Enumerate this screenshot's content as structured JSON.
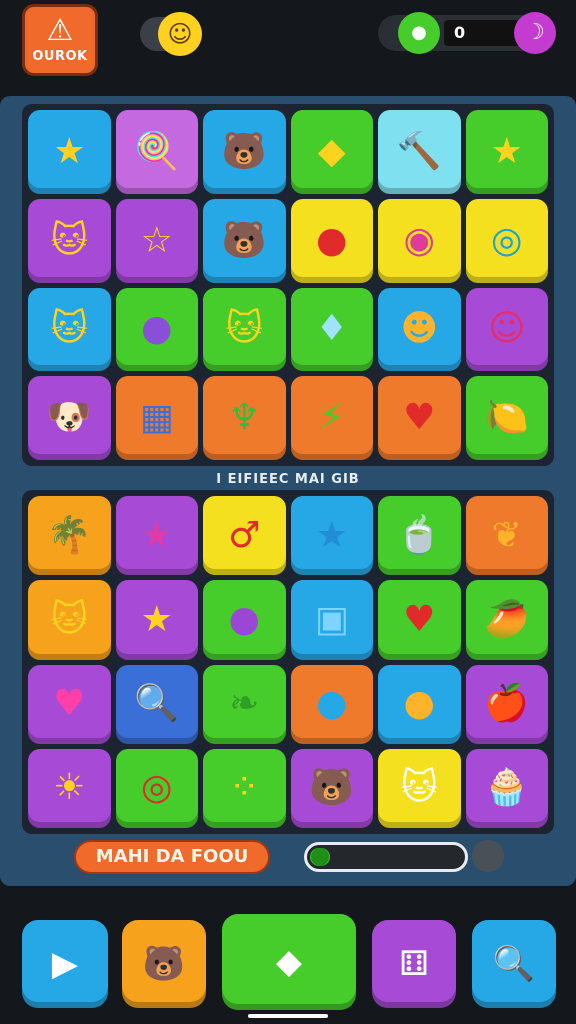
{
  "header": {
    "logo_glyph": "⚠",
    "logo_text": "OUROK",
    "toggle_icon": "☺",
    "gem_icon": "●",
    "counter_value": "0",
    "moon_icon": "☽"
  },
  "board": {
    "top_grid": [
      {
        "color": "#27a8e6",
        "icon": "★",
        "icon_color": "#ffd21f"
      },
      {
        "color": "#c569e0",
        "icon": "🍭",
        "icon_color": "#ffcc33"
      },
      {
        "color": "#27a8e6",
        "icon": "🐻",
        "icon_color": "#e39a55"
      },
      {
        "color": "#46cc2b",
        "icon": "◆",
        "icon_color": "#ffd21f"
      },
      {
        "color": "#7fe0f0",
        "icon": "🔨",
        "icon_color": "#f07a2c"
      },
      {
        "color": "#46cc2b",
        "icon": "★",
        "icon_color": "#ffd21f"
      },
      {
        "color": "#a74bd6",
        "icon": "🐱",
        "icon_color": "#ffd21f"
      },
      {
        "color": "#a74bd6",
        "icon": "☆",
        "icon_color": "#ffd21f"
      },
      {
        "color": "#27a8e6",
        "icon": "🐻",
        "icon_color": "#e39a55"
      },
      {
        "color": "#f4e01e",
        "icon": "●",
        "icon_color": "#e12b2b"
      },
      {
        "color": "#f4e01e",
        "icon": "◉",
        "icon_color": "#e03a9a"
      },
      {
        "color": "#f4e01e",
        "icon": "◎",
        "icon_color": "#1aa3d6"
      },
      {
        "color": "#27a8e6",
        "icon": "🐱",
        "icon_color": "#ffd21f"
      },
      {
        "color": "#46cc2b",
        "icon": "●",
        "icon_color": "#8a4fd8"
      },
      {
        "color": "#46cc2b",
        "icon": "🐱",
        "icon_color": "#ffd21f"
      },
      {
        "color": "#46cc2b",
        "icon": "♦",
        "icon_color": "#9fe3ff"
      },
      {
        "color": "#27a8e6",
        "icon": "☻",
        "icon_color": "#ffb32b"
      },
      {
        "color": "#a74bd6",
        "icon": "☺",
        "icon_color": "#e62d6a"
      },
      {
        "color": "#a74bd6",
        "icon": "🐶",
        "icon_color": "#ffd21f"
      },
      {
        "color": "#f07a2c",
        "icon": "▦",
        "icon_color": "#3b6fd8"
      },
      {
        "color": "#f07a2c",
        "icon": "♆",
        "icon_color": "#2fbf3a"
      },
      {
        "color": "#f07a2c",
        "icon": "⚡",
        "icon_color": "#46cc2b"
      },
      {
        "color": "#f07a2c",
        "icon": "♥",
        "icon_color": "#e12b2b"
      },
      {
        "color": "#46cc2b",
        "icon": "🍋",
        "icon_color": "#ffe14a"
      }
    ],
    "mid_label": "I EIFIEEC MAI GIB",
    "bottom_grid": [
      {
        "color": "#f7a21c",
        "icon": "🌴",
        "icon_color": "#46cc2b"
      },
      {
        "color": "#a74bd6",
        "icon": "★",
        "icon_color": "#e03aa8"
      },
      {
        "color": "#f4e01e",
        "icon": "♂",
        "icon_color": "#e12b2b"
      },
      {
        "color": "#27a8e6",
        "icon": "★",
        "icon_color": "#1f8ed6"
      },
      {
        "color": "#46cc2b",
        "icon": "🍵",
        "icon_color": "#f7e0a0"
      },
      {
        "color": "#f07a2c",
        "icon": "❦",
        "icon_color": "#ffb32b"
      },
      {
        "color": "#f7a21c",
        "icon": "🐱",
        "icon_color": "#ffd21f"
      },
      {
        "color": "#a74bd6",
        "icon": "★",
        "icon_color": "#ffd21f"
      },
      {
        "color": "#46cc2b",
        "icon": "●",
        "icon_color": "#9b47d6"
      },
      {
        "color": "#27a8e6",
        "icon": "▣",
        "icon_color": "#7fd4ff"
      },
      {
        "color": "#46cc2b",
        "icon": "♥",
        "icon_color": "#e12b2b"
      },
      {
        "color": "#46cc2b",
        "icon": "🥭",
        "icon_color": "#ffd21f"
      },
      {
        "color": "#a74bd6",
        "icon": "♥",
        "icon_color": "#ff3fa8"
      },
      {
        "color": "#3b6fd8",
        "icon": "🔍",
        "icon_color": "#ffd21f"
      },
      {
        "color": "#46cc2b",
        "icon": "❧",
        "icon_color": "#2f9e27"
      },
      {
        "color": "#f07a2c",
        "icon": "●",
        "icon_color": "#27a8e6"
      },
      {
        "color": "#27a8e6",
        "icon": "●",
        "icon_color": "#ffb32b"
      },
      {
        "color": "#a74bd6",
        "icon": "🍎",
        "icon_color": "#e12b2b"
      },
      {
        "color": "#a74bd6",
        "icon": "☀",
        "icon_color": "#ffd21f"
      },
      {
        "color": "#46cc2b",
        "icon": "◎",
        "icon_color": "#e12b2b"
      },
      {
        "color": "#46cc2b",
        "icon": "⁘",
        "icon_color": "#ffd21f"
      },
      {
        "color": "#a74bd6",
        "icon": "🐻",
        "icon_color": "#e39a55"
      },
      {
        "color": "#f4e01e",
        "icon": "🐱",
        "icon_color": "#ffffff"
      },
      {
        "color": "#a74bd6",
        "icon": "🧁",
        "icon_color": "#ffd21f"
      }
    ]
  },
  "action_label": "MAHI DA FOOU",
  "progress_fraction": 0.13,
  "nav": [
    {
      "name": "play",
      "icon": "▶",
      "color": "#27a8e6"
    },
    {
      "name": "character",
      "icon": "🐻",
      "color": "#f7a21c"
    },
    {
      "name": "home",
      "icon": "◆",
      "color": "#46cc2b"
    },
    {
      "name": "dice",
      "icon": "⚅",
      "color": "#a74bd6"
    },
    {
      "name": "search",
      "icon": "🔍",
      "color": "#27a8e6"
    }
  ]
}
